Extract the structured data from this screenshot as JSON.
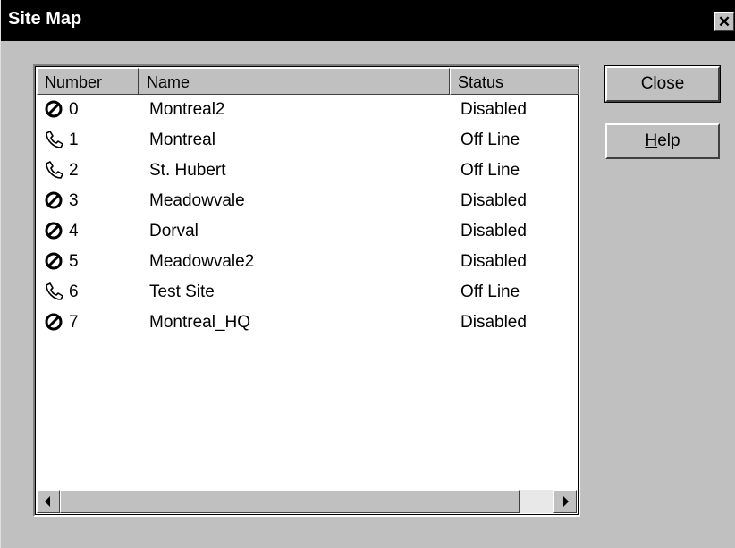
{
  "window": {
    "title": "Site Map",
    "close_glyph": "✕"
  },
  "list": {
    "columns": [
      "Number",
      "Name",
      "Status"
    ],
    "rows": [
      {
        "icon": "disabled-icon",
        "number": "0",
        "name": "Montreal2",
        "status": "Disabled"
      },
      {
        "icon": "phone-icon",
        "number": "1",
        "name": "Montreal",
        "status": "Off Line"
      },
      {
        "icon": "phone-icon",
        "number": "2",
        "name": "St. Hubert",
        "status": "Off Line"
      },
      {
        "icon": "disabled-icon",
        "number": "3",
        "name": "Meadowvale",
        "status": "Disabled"
      },
      {
        "icon": "disabled-icon",
        "number": "4",
        "name": "Dorval",
        "status": "Disabled"
      },
      {
        "icon": "disabled-icon",
        "number": "5",
        "name": "Meadowvale2",
        "status": "Disabled"
      },
      {
        "icon": "phone-icon",
        "number": "6",
        "name": "Test Site",
        "status": "Off Line"
      },
      {
        "icon": "disabled-icon",
        "number": "7",
        "name": "Montreal_HQ",
        "status": "Disabled"
      }
    ]
  },
  "buttons": {
    "close_label": "Close",
    "help_label": "Help",
    "help_accel": "H",
    "help_rest": "elp"
  }
}
